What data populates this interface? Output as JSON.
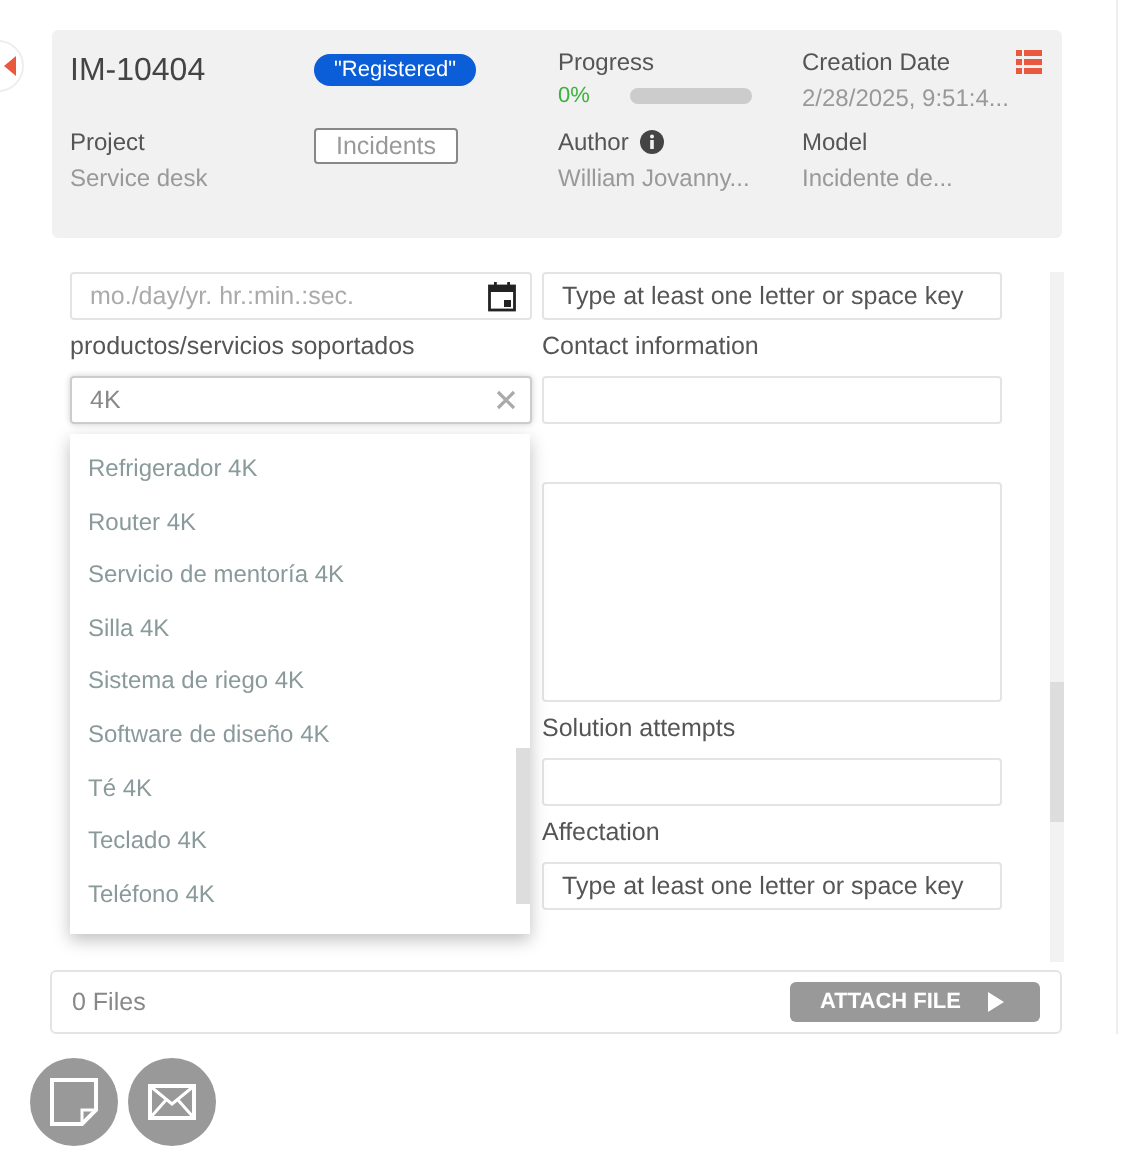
{
  "header": {
    "id": "IM-10404",
    "status": "\"Registered\"",
    "progress": {
      "label": "Progress",
      "value": "0%",
      "level": 0
    },
    "creation_date": {
      "label": "Creation Date",
      "value": "2/28/2025, 9:51:4..."
    },
    "project": {
      "label": "Project",
      "value": "Service desk"
    },
    "tag": "Incidents",
    "author": {
      "label": "Author",
      "value": "William Jovanny..."
    },
    "model": {
      "label": "Model",
      "value": "Incidente de..."
    }
  },
  "form": {
    "date_field": {
      "placeholder": "mo./day/yr. hr.:min.:sec."
    },
    "lookup_field": {
      "placeholder": "Type at least one letter or space key"
    },
    "products": {
      "label": "productos/servicios soportados",
      "value": "4K"
    },
    "contact": {
      "label": "Contact information"
    },
    "options": [
      "Refrigerador 4K",
      "Router 4K",
      "Servicio de mentoría 4K",
      "Silla 4K",
      "Sistema de riego 4K",
      "Software de diseño 4K",
      "Té 4K",
      "Teclado 4K",
      "Teléfono 4K"
    ],
    "solution": {
      "label": "Solution attempts"
    },
    "affectation": {
      "label": "Affectation",
      "placeholder": "Type at least one letter or space key"
    }
  },
  "files": {
    "count": "0 Files",
    "button": "ATTACH FILE"
  }
}
